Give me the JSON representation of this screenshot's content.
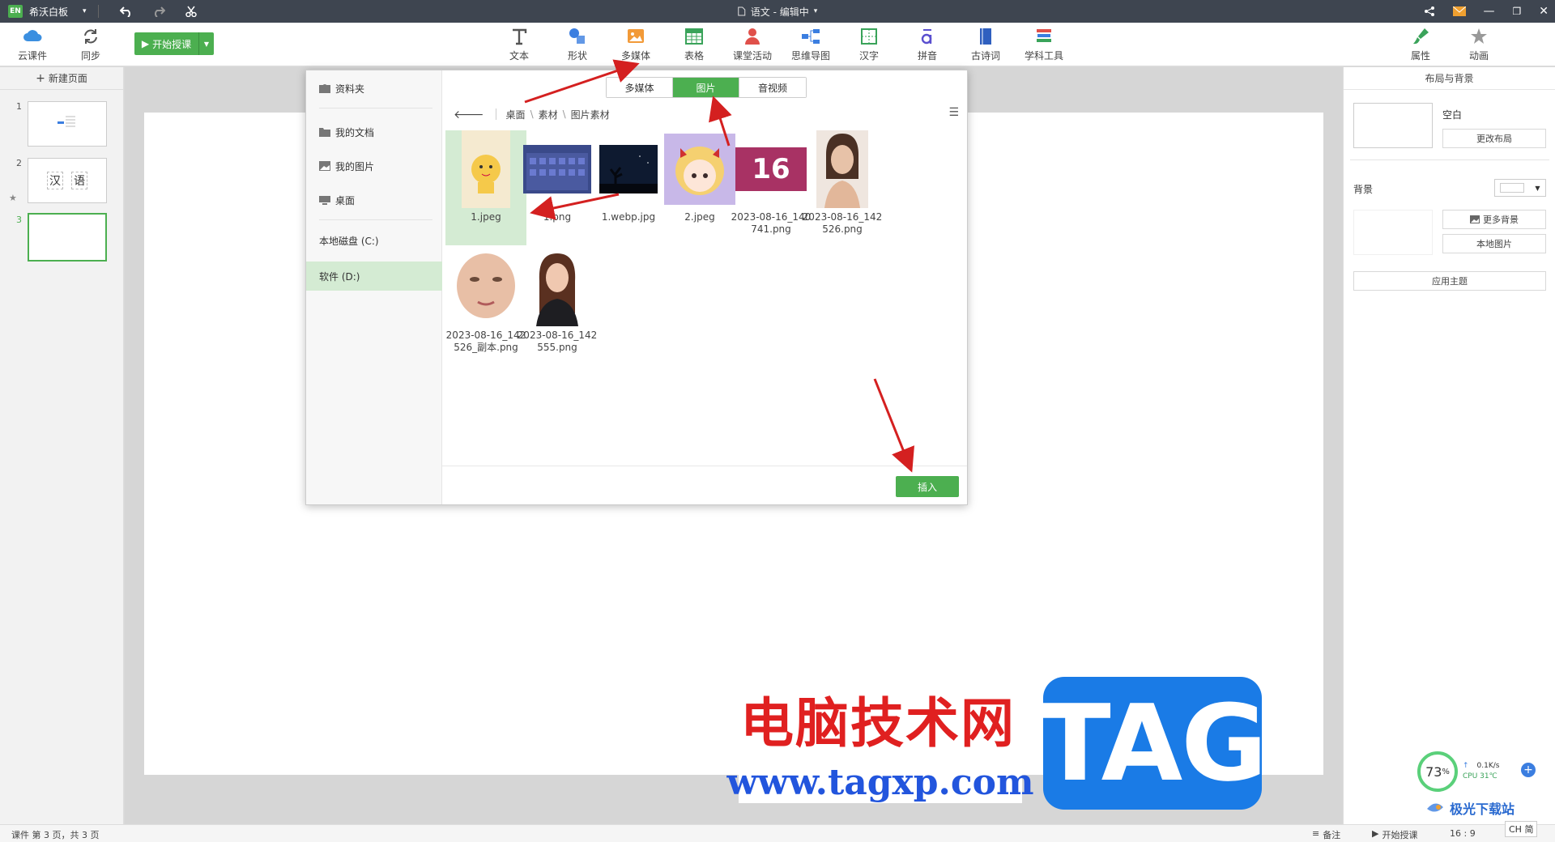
{
  "titlebar": {
    "logo_text": "EN",
    "app_name": "希沃白板",
    "doc_title": "语文 - 编辑中"
  },
  "toolbar": {
    "cloud_label": "云课件",
    "sync_label": "同步",
    "start_label": "开始授课",
    "tools": [
      {
        "label": "文本"
      },
      {
        "label": "形状"
      },
      {
        "label": "多媒体"
      },
      {
        "label": "表格"
      },
      {
        "label": "课堂活动"
      },
      {
        "label": "思维导图"
      },
      {
        "label": "汉字"
      },
      {
        "label": "拼音"
      },
      {
        "label": "古诗词"
      },
      {
        "label": "学科工具"
      }
    ],
    "props_label": "属性",
    "anim_label": "动画"
  },
  "left_panel": {
    "new_page_label": "新建页面",
    "slides": [
      {
        "num": "1"
      },
      {
        "num": "2",
        "chars": [
          "汉",
          "语"
        ]
      },
      {
        "num": "3"
      }
    ]
  },
  "right_panel": {
    "title": "布局与背景",
    "layout_name": "空白",
    "change_layout": "更改布局",
    "bg_label": "背景",
    "more_bg": "更多背景",
    "local_image": "本地图片",
    "apply_theme": "应用主题"
  },
  "dialog": {
    "sidebar": [
      {
        "label": "资料夹"
      },
      {
        "label": "我的文档"
      },
      {
        "label": "我的图片"
      },
      {
        "label": "桌面"
      },
      {
        "label": "本地磁盘 (C:)"
      },
      {
        "label": "软件 (D:)"
      }
    ],
    "tabs": [
      {
        "label": "多媒体"
      },
      {
        "label": "图片"
      },
      {
        "label": "音视频"
      }
    ],
    "active_tab": "图片",
    "breadcrumb": [
      "桌面",
      "素材",
      "图片素材"
    ],
    "files": [
      {
        "name": "1.jpeg"
      },
      {
        "name": "1.png"
      },
      {
        "name": "1.webp.jpg"
      },
      {
        "name": "2.jpeg"
      },
      {
        "name": "2023-08-16_140741.png",
        "thumb_text": "16"
      },
      {
        "name": "2023-08-16_142526.png"
      },
      {
        "name": "2023-08-16_142526_副本.png"
      },
      {
        "name": "2023-08-16_142555.png"
      }
    ],
    "insert_label": "插入"
  },
  "statusbar": {
    "page_info": "课件 第 3 页，共 3 页",
    "notes": "备注",
    "start": "开始授课",
    "ratio": "16 : 9"
  },
  "watermark": {
    "cn": "电脑技术网",
    "url": "www.tagxp.com",
    "tag": "TAG"
  },
  "widget": {
    "cpu_percent": "73",
    "net_speed": "0.1K/s",
    "cpu_temp": "CPU 31℃",
    "ime": "CH 简",
    "site": "极光下载站"
  },
  "colors": {
    "accent": "#4caf50",
    "annotation": "#d42020",
    "tag_blue": "#1a7be6"
  }
}
